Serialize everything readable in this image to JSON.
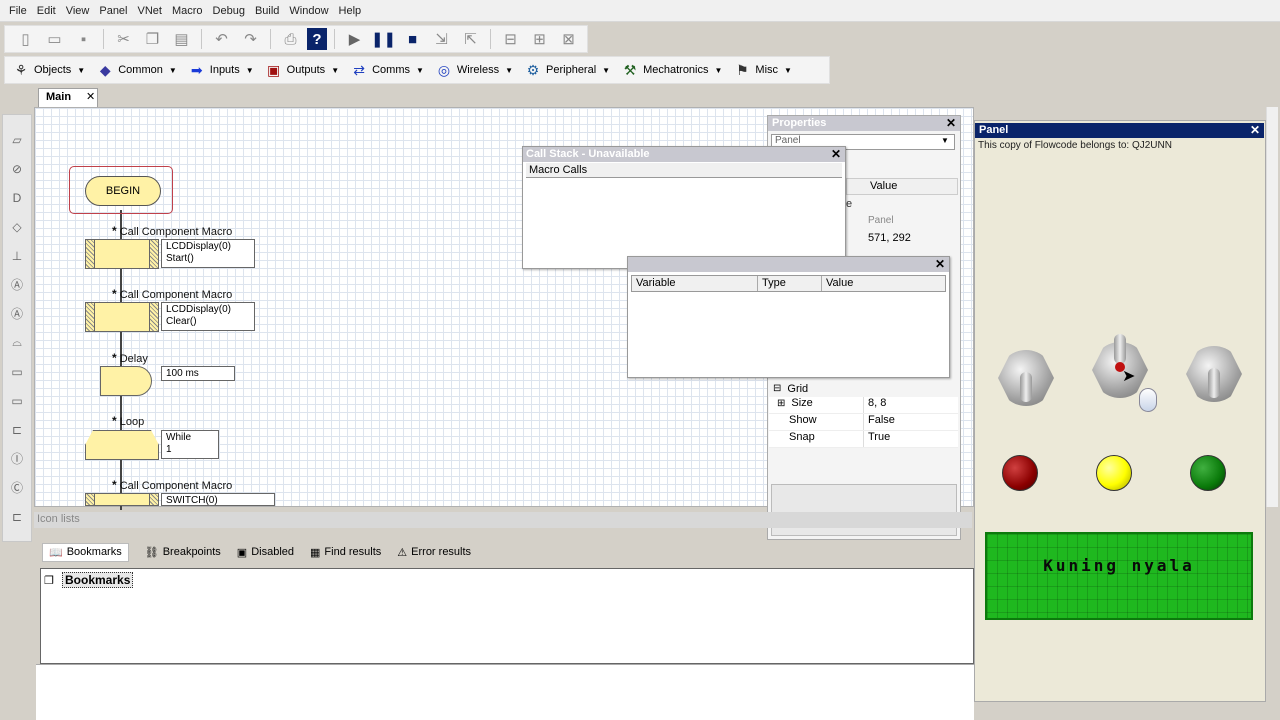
{
  "menu": [
    "File",
    "Edit",
    "View",
    "Panel",
    "VNet",
    "Macro",
    "Debug",
    "Build",
    "Window",
    "Help"
  ],
  "toolbar_icons": [
    "new-icon",
    "open-icon",
    "save-icon",
    "cut-icon",
    "copy-icon",
    "paste-icon",
    "undo-icon",
    "redo-icon",
    "print-icon",
    "help-icon",
    "run-icon",
    "pause-icon",
    "stop-icon",
    "step-into-icon",
    "step-over-icon",
    "tool-a-icon",
    "tool-b-icon",
    "tool-c-icon"
  ],
  "component_toolbar": [
    {
      "label": "Objects",
      "icon": "objects-icon"
    },
    {
      "label": "Common",
      "icon": "common-icon"
    },
    {
      "label": "Inputs",
      "icon": "inputs-icon"
    },
    {
      "label": "Outputs",
      "icon": "outputs-icon"
    },
    {
      "label": "Comms",
      "icon": "comms-icon"
    },
    {
      "label": "Wireless",
      "icon": "wireless-icon"
    },
    {
      "label": "Peripheral",
      "icon": "peripheral-icon"
    },
    {
      "label": "Mechatronics",
      "icon": "mechatronics-icon"
    },
    {
      "label": "Misc",
      "icon": "misc-icon"
    }
  ],
  "tab": {
    "label": "Main"
  },
  "flowchart": {
    "begin": "BEGIN",
    "call1": {
      "title": "Call Component Macro",
      "line1": "LCDDisplay(0)",
      "line2": "Start()"
    },
    "call2": {
      "title": "Call Component Macro",
      "line1": "LCDDisplay(0)",
      "line2": "Clear()"
    },
    "delay": {
      "title": "Delay",
      "value": "100 ms"
    },
    "loop": {
      "title": "Loop",
      "line1": "While",
      "line2": "1"
    },
    "call3": {
      "title": "Call Component Macro",
      "line1": "SWITCH(0)"
    }
  },
  "properties": {
    "title": "Properties",
    "combo": "Panel",
    "col_value": "Value",
    "row_e": "e",
    "row_panel_value": "Panel",
    "row_pos_value": "571, 292",
    "grid_group": "Grid",
    "grid_rows": [
      {
        "key": "Size",
        "value": "8, 8"
      },
      {
        "key": "Show",
        "value": "False"
      },
      {
        "key": "Snap",
        "value": "True"
      }
    ]
  },
  "callstack": {
    "title": "Call Stack - Unavailable",
    "header": "Macro Calls"
  },
  "variables": {
    "headers": [
      "Variable",
      "Type",
      "Value"
    ]
  },
  "panel": {
    "title": "Panel",
    "copy_note": "This copy of Flowcode belongs to: QJ2UNN",
    "leds": [
      {
        "color": "#8b0000"
      },
      {
        "color": "#ffff00"
      },
      {
        "color": "#0a7a0a"
      }
    ],
    "lcd_text": "Kuning nyala"
  },
  "bottom": {
    "icon_lists": "Icon lists",
    "tabs": [
      {
        "label": "Bookmarks",
        "icon": "bookmarks-icon"
      },
      {
        "label": "Breakpoints",
        "icon": "breakpoints-icon"
      },
      {
        "label": "Disabled",
        "icon": "disabled-icon"
      },
      {
        "label": "Find results",
        "icon": "find-results-icon"
      },
      {
        "label": "Error results",
        "icon": "error-results-icon"
      }
    ],
    "tree_item": "Bookmarks"
  }
}
